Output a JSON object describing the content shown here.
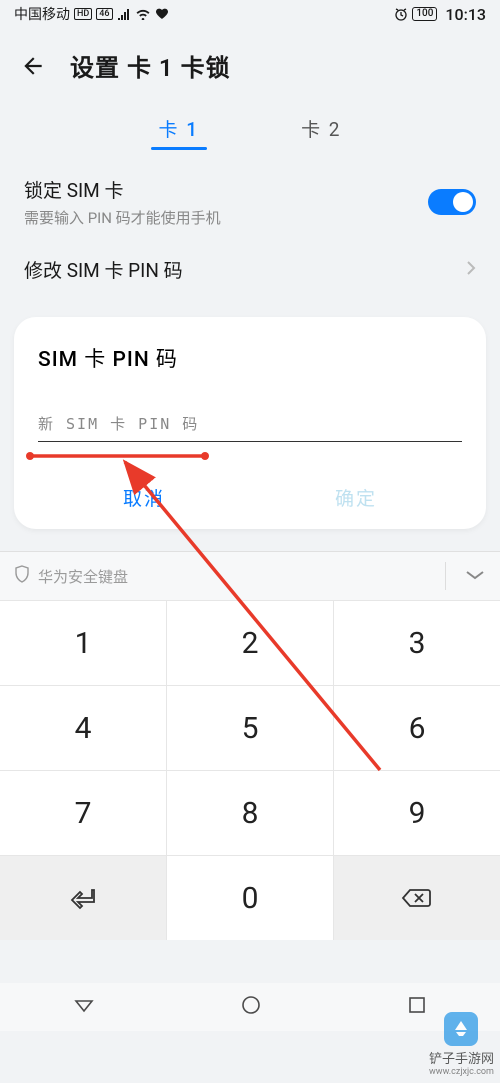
{
  "status": {
    "carrier": "中国移动",
    "hd_badge": "HD",
    "net_badge": "46",
    "time": "10:13",
    "battery": "100"
  },
  "header": {
    "title": "设置 卡 1 卡锁"
  },
  "tabs": {
    "tab1": "卡 1",
    "tab2": "卡 2"
  },
  "settings": {
    "lock_title": "锁定 SIM 卡",
    "lock_sub": "需要输入 PIN 码才能使用手机",
    "change_pin": "修改 SIM 卡 PIN 码"
  },
  "dialog": {
    "title": "SIM 卡 PIN 码",
    "placeholder": "新 SIM 卡 PIN 码",
    "cancel": "取消",
    "ok": "确定"
  },
  "keyboard": {
    "label": "华为安全键盘",
    "keys": {
      "k1": "1",
      "k2": "2",
      "k3": "3",
      "k4": "4",
      "k5": "5",
      "k6": "6",
      "k7": "7",
      "k8": "8",
      "k9": "9",
      "k0": "0"
    }
  },
  "watermark": {
    "name": "铲子手游网",
    "url": "www.czjxjc.com"
  }
}
